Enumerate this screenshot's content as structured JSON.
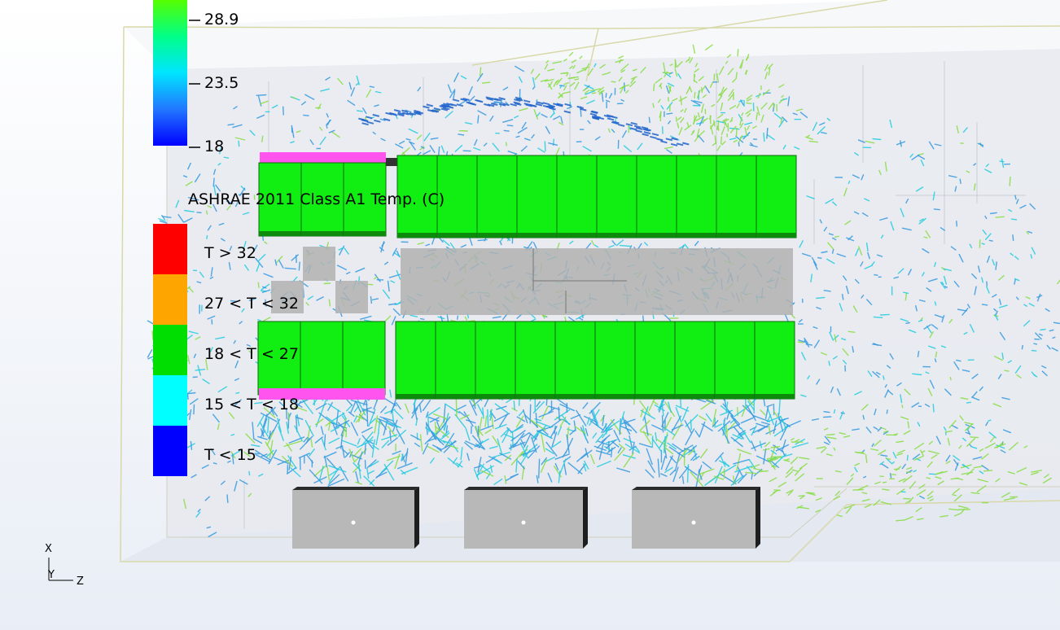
{
  "colorbar": {
    "ticks": [
      "28.9",
      "23.5",
      "18"
    ]
  },
  "legend": {
    "title": "ASHRAE 2011 Class A1 Temp. (C)",
    "items": [
      {
        "label": "T > 32",
        "color": "#ff0000"
      },
      {
        "label": "27 < T < 32",
        "color": "#ffa500"
      },
      {
        "label": "18 < T < 27",
        "color": "#00dd00"
      },
      {
        "label": "15 < T < 18",
        "color": "#00ffff"
      },
      {
        "label": "T < 15",
        "color": "#0000ff"
      }
    ]
  },
  "axes": {
    "x": "X",
    "y": "Y",
    "z": "Z"
  },
  "colors": {
    "rack": "#11ee11",
    "rack_top": "#22ff22",
    "pdu_stripe": "#ff55ee",
    "crac": "#b8b8b8",
    "floor_tile": "#b2b2b2",
    "room_edge": "#d8d8a8",
    "vector_blue": "#3399e0",
    "vector_cyan": "#22cce0",
    "vector_green": "#88dd44"
  }
}
